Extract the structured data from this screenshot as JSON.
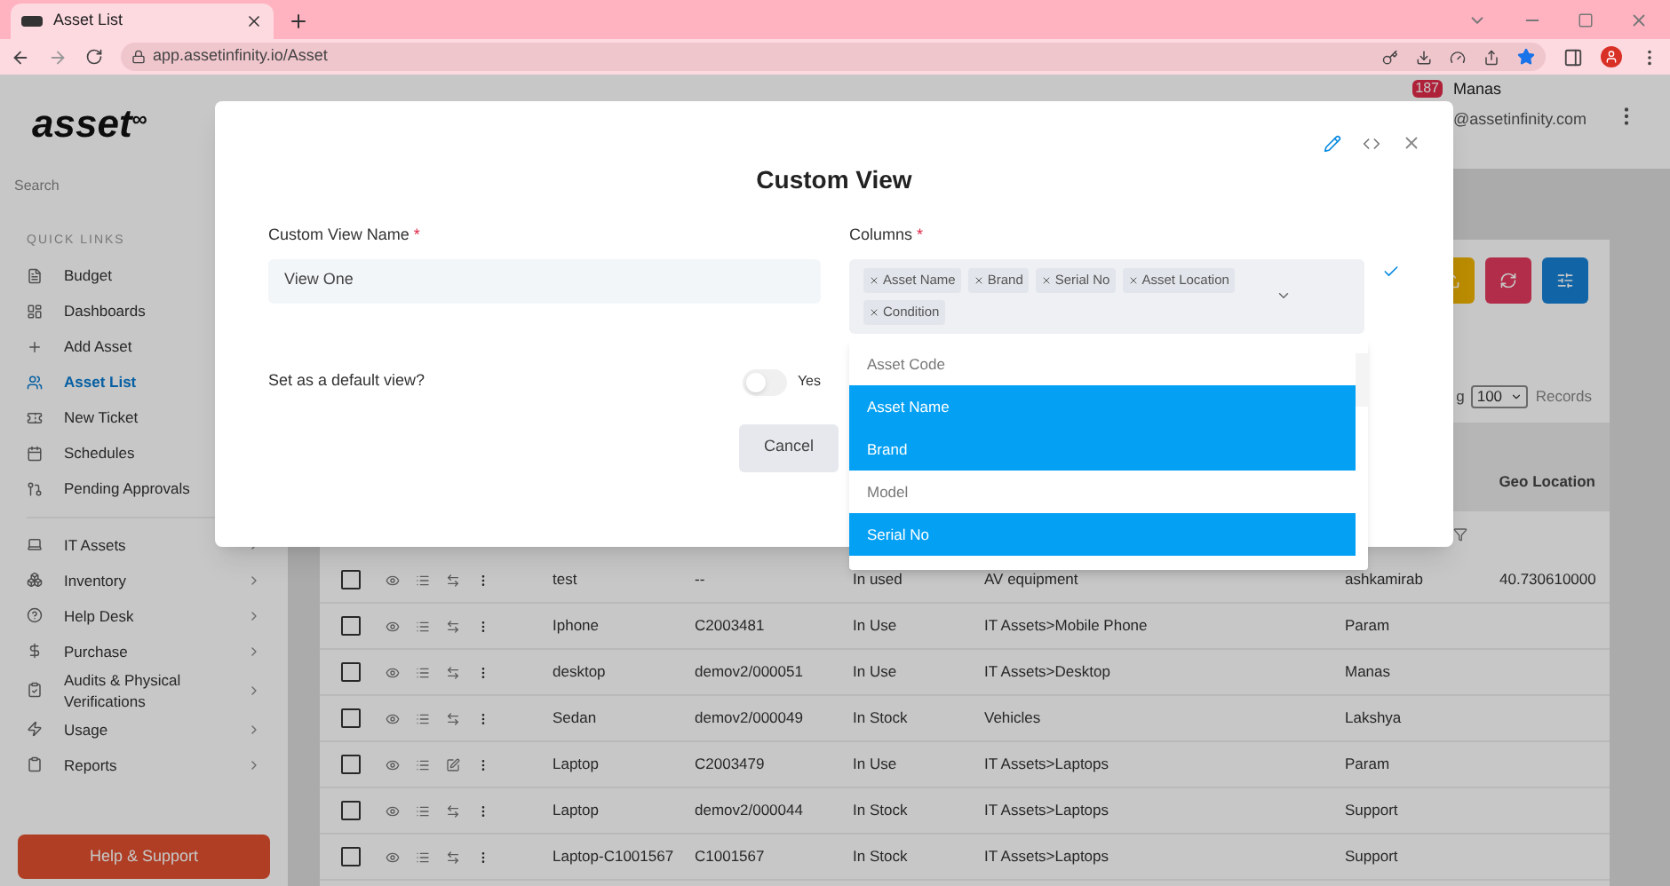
{
  "browser": {
    "tab_title": "Asset List",
    "url": "app.assetinfinity.io/Asset"
  },
  "header": {
    "logo": "asset",
    "logo_mark": "∞",
    "badge": "187",
    "user_name": "Manas",
    "user_email": "@assetinfinity.com"
  },
  "sidebar": {
    "search": "Search",
    "section": "QUICK LINKS",
    "quick_links": [
      {
        "label": "Budget",
        "selected": false
      },
      {
        "label": "Dashboards",
        "selected": false
      },
      {
        "label": "Add Asset",
        "selected": false
      },
      {
        "label": "Asset List",
        "selected": true
      },
      {
        "label": "New Ticket",
        "selected": false
      },
      {
        "label": "Schedules",
        "selected": false
      },
      {
        "label": "Pending Approvals",
        "selected": false
      }
    ],
    "modules": [
      {
        "label": "IT Assets"
      },
      {
        "label": "Inventory"
      },
      {
        "label": "Help Desk"
      },
      {
        "label": "Purchase"
      },
      {
        "label": "Audits & Physical Verifications"
      },
      {
        "label": "Usage"
      },
      {
        "label": "Reports"
      }
    ],
    "help": "Help & Support"
  },
  "toolbar": {
    "showing_fragment": "g",
    "page_size": "100",
    "records_label": "Records"
  },
  "table": {
    "geo_header": "Geo Location",
    "rows": [
      {
        "name": "test",
        "code": "--",
        "status": "In used",
        "category": "AV equipment",
        "user": "ashkamirab",
        "geo": "40.730610000",
        "edit": false,
        "checked": false
      },
      {
        "name": "Iphone",
        "code": "C2003481",
        "status": "In Use",
        "category": "IT Assets>Mobile Phone",
        "user": "Param",
        "edit": false,
        "checked": false
      },
      {
        "name": "desktop",
        "code": "demov2/000051",
        "status": "In Use",
        "category": "IT Assets>Desktop",
        "user": "Manas",
        "edit": false,
        "checked": false
      },
      {
        "name": "Sedan",
        "code": "demov2/000049",
        "status": "In Stock",
        "category": "Vehicles",
        "user": "Lakshya",
        "edit": false,
        "checked": false
      },
      {
        "name": "Laptop",
        "code": "C2003479",
        "status": "In Use",
        "category": "IT Assets>Laptops",
        "user": "Param",
        "edit": true,
        "checked": false
      },
      {
        "name": "Laptop",
        "code": "demov2/000044",
        "status": "In Stock",
        "category": "IT Assets>Laptops",
        "user": "Support",
        "edit": false,
        "checked": false
      },
      {
        "name": "Laptop-C1001567",
        "code": "C1001567",
        "status": "In Stock",
        "category": "IT Assets>Laptops",
        "user": "Support",
        "edit": false,
        "checked": false
      }
    ]
  },
  "modal": {
    "title": "Custom View",
    "name_label": "Custom View Name",
    "name_value": "View One",
    "columns_label": "Columns",
    "required_mark": "*",
    "chips": [
      "Asset Name",
      "Brand",
      "Serial No",
      "Asset Location",
      "Condition"
    ],
    "options": [
      {
        "label": "Asset Code",
        "selected": false
      },
      {
        "label": "Asset Name",
        "selected": true
      },
      {
        "label": "Brand",
        "selected": true
      },
      {
        "label": "Model",
        "selected": false
      },
      {
        "label": "Serial No",
        "selected": true
      }
    ],
    "default_label": "Set as a default view?",
    "default_on": false,
    "default_text": "Yes",
    "cancel": "Cancel"
  }
}
